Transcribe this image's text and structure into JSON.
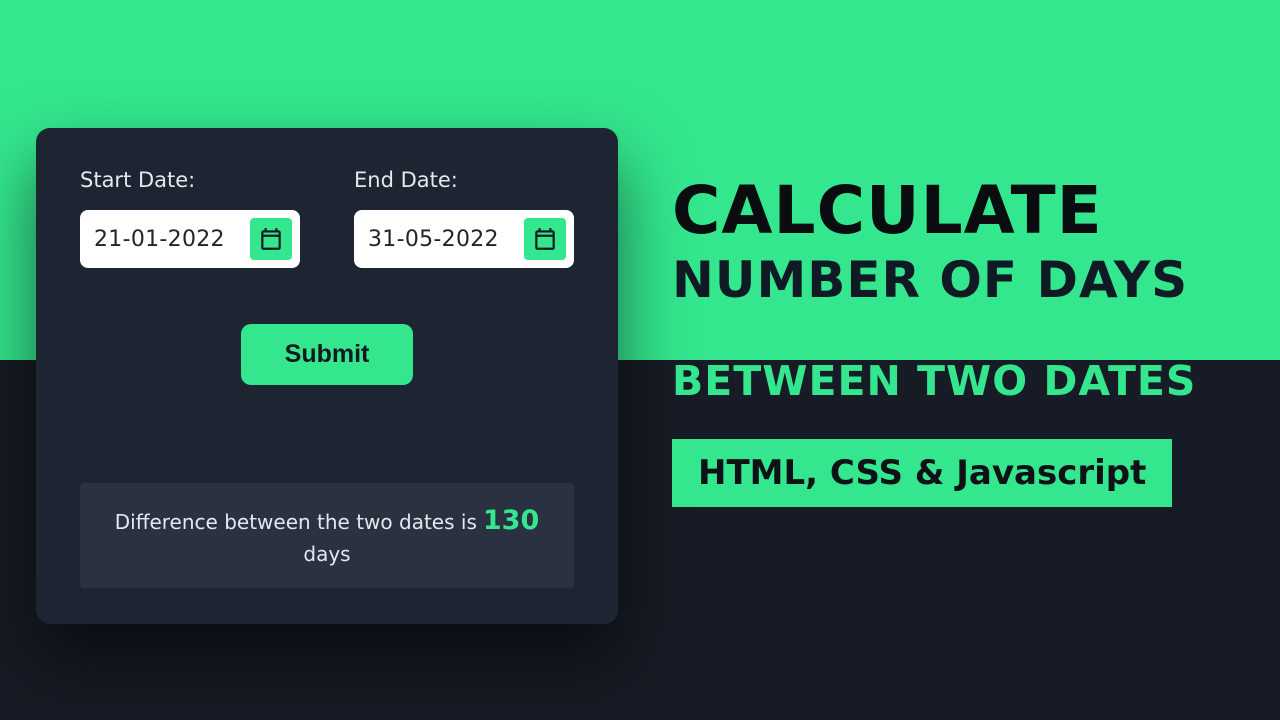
{
  "form": {
    "start_label": "Start Date:",
    "end_label": "End Date:",
    "start_value": "21-01-2022",
    "end_value": "31-05-2022",
    "submit_label": "Submit"
  },
  "result": {
    "prefix": "Difference between the two dates is",
    "value": "130",
    "suffix": "days"
  },
  "headline": {
    "line1": "CALCULATE",
    "line2": "NUMBER OF DAYS",
    "line3": "BETWEEN TWO DATES",
    "tech": "HTML, CSS & Javascript"
  },
  "colors": {
    "accent": "#34e78e",
    "dark": "#161b25",
    "card": "#1e2532"
  }
}
